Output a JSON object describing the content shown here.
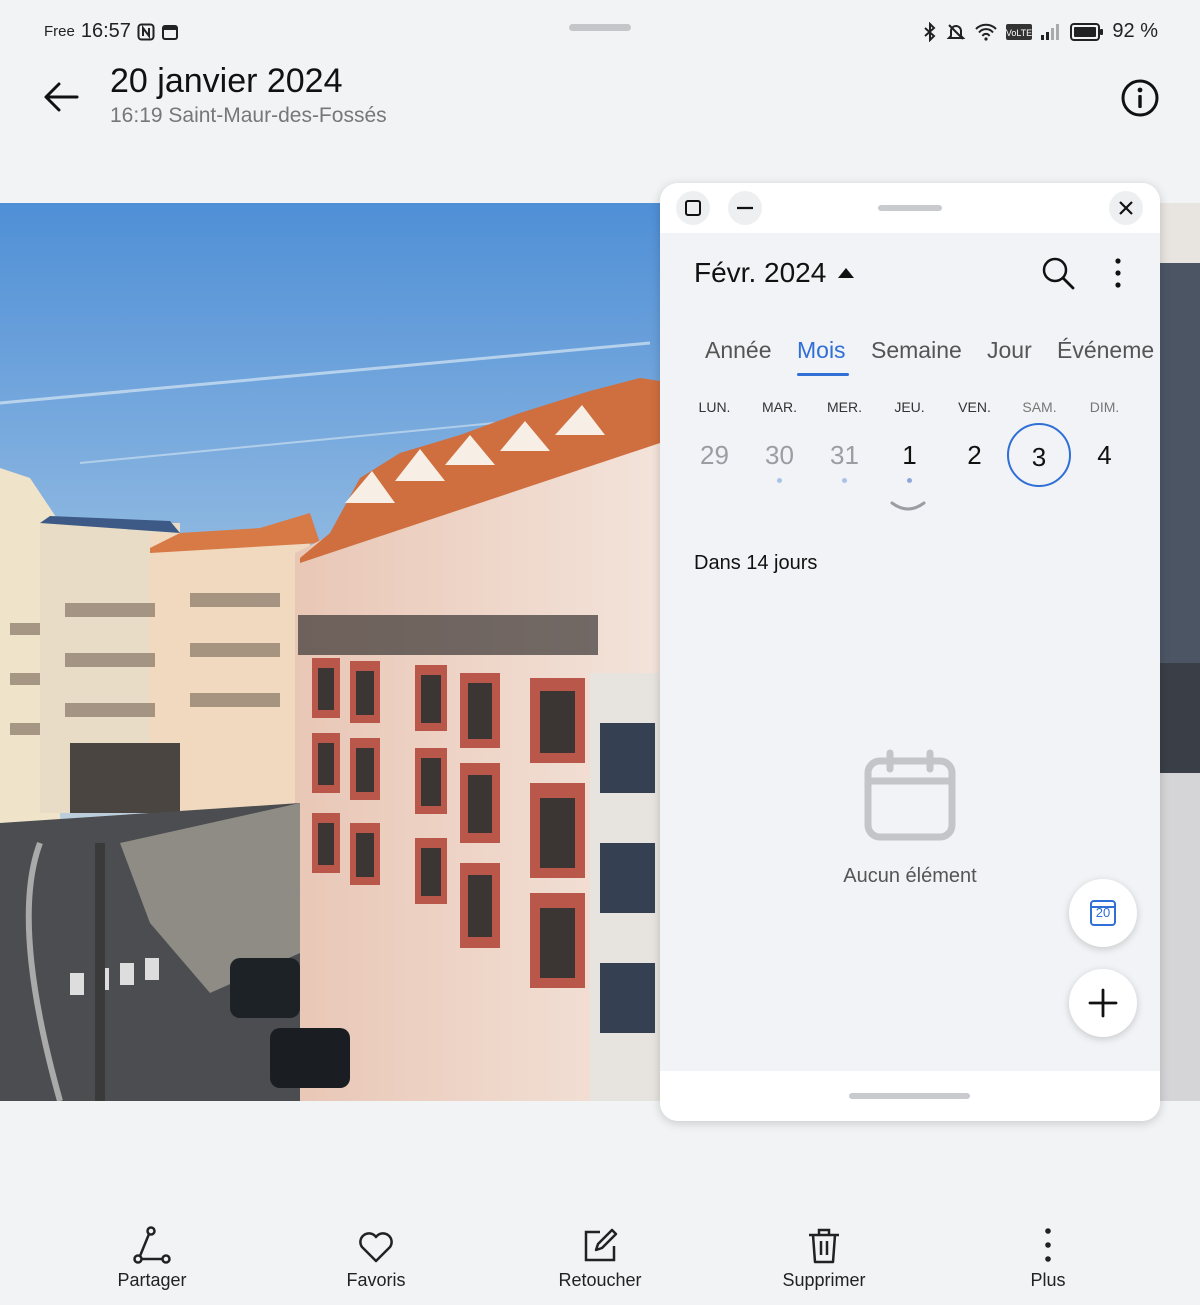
{
  "status_bar": {
    "carrier": "Free",
    "time": "16:57",
    "battery": "92 %"
  },
  "header": {
    "title": "20 janvier 2024",
    "subtitle": "16:19 Saint-Maur-des-Fossés"
  },
  "calendar": {
    "month_title": "Févr. 2024",
    "tabs": [
      {
        "label": "Année"
      },
      {
        "label": "Mois"
      },
      {
        "label": "Semaine"
      },
      {
        "label": "Jour"
      },
      {
        "label": "Événeme"
      }
    ],
    "active_tab": "Mois",
    "weekdays": [
      "LUN.",
      "MAR.",
      "MER.",
      "JEU.",
      "VEN.",
      "SAM.",
      "DIM."
    ],
    "days": [
      "29",
      "30",
      "31",
      "1",
      "2",
      "3",
      "4"
    ],
    "selected_day": "3",
    "relative_label": "Dans 14 jours",
    "empty_message": "Aucun élément",
    "today_button_day": "20",
    "accent_color": "#2f6fd6"
  },
  "toolbar": {
    "items": [
      {
        "label": "Partager",
        "icon": "share-icon"
      },
      {
        "label": "Favoris",
        "icon": "heart-icon"
      },
      {
        "label": "Retoucher",
        "icon": "edit-icon"
      },
      {
        "label": "Supprimer",
        "icon": "trash-icon"
      },
      {
        "label": "Plus",
        "icon": "more-vertical-icon"
      }
    ]
  }
}
